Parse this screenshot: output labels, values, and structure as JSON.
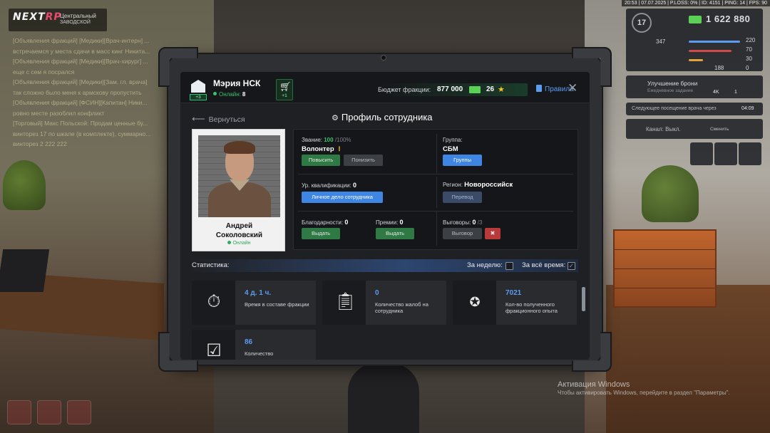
{
  "hud": {
    "logo_main": "NEXT",
    "logo_accent": "RP",
    "server_name": "Центральный",
    "server_sub": "ЗАВОДСКОЙ",
    "topbar": "20:53 | 07.07.2025 | P.LOSS: 0% | ID: 4151 | PING: 14 | FPS: 90",
    "level": "17",
    "money": "1 622 880",
    "stat_a": "347",
    "stat_b": "220",
    "stat_c": "70",
    "stat_d": "30",
    "stat_e": "0",
    "stat_f": "188",
    "stat_g": "0",
    "armor_upgrade": "Улучшение брони",
    "armor_sub": "Ежедневное задание",
    "armor_4k": "4K",
    "armor_1": "1",
    "doctor_visit_label": "Следующее посещение врача через",
    "doctor_visit_time": "04:09",
    "channel_label": "Канал: Выкл.",
    "channel_change": "Сменить"
  },
  "chat": [
    "[Объявления фракций] [Медики][Врач-интерн] ...",
    "встречаемся у места сдачи в масс кинг Никита...",
    "[Объявления фракций] [Медики][Врач-хирург] ...",
    "еще с сем я посрался",
    "[Объявления фракций] [Медики][Зам. гл. врача]",
    "так сложно было меня к армскову пропустить",
    "[Объявления фракций] [ФСИН][Капитан] Ники...",
    "ровно месте разоблил конфликт",
    "[Торговый] Макс Польской: Продам ценные бу...",
    "винторез 17 по шкале (в комплекте), суммарно...",
    "винторез 2 222 222"
  ],
  "header": {
    "title": "Мэрия НСК",
    "online_label": "Онлайн:",
    "online_count": "8",
    "city_level": "+3",
    "cart_level": "+1",
    "budget_label": "Бюджет фракции:",
    "budget_amount": "877 000",
    "budget_count": "26",
    "rules": "Правила",
    "close": "✕"
  },
  "nav": {
    "back": "Вернуться",
    "page_title": "Профиль сотрудника"
  },
  "employee": {
    "first_name": "Андрей",
    "last_name": "Соколовский",
    "status": "Онлайн"
  },
  "info": {
    "rank_label": "Звание:",
    "rank_current": "100",
    "rank_max": "/100%",
    "rank_name": "Волонтер",
    "promote": "Повысить",
    "demote": "Понизить",
    "group_label": "Группа:",
    "group_name": "СБМ",
    "groups_btn": "Группы",
    "qual_label": "Ур. квалификации:",
    "qual_value": "0",
    "personal_file_btn": "Личное дело сотрудника",
    "region_label": "Регион:",
    "region_value": "Новороссийск",
    "transfer_btn": "Перевод",
    "thanks_label": "Благодарности:",
    "thanks_value": "0",
    "thanks_btn": "Выдать",
    "bonus_label": "Премии:",
    "bonus_value": "0",
    "bonus_btn": "Выдать",
    "reprimand_label": "Выговоры:",
    "reprimand_value": "0",
    "reprimand_max": "/3",
    "reprimand_btn": "Выговор"
  },
  "stats": {
    "label": "Статистика:",
    "week": "За неделю:",
    "week_checked": false,
    "alltime": "За всё время:",
    "alltime_checked": true,
    "cards": [
      {
        "icon": "stopwatch-icon",
        "value": "4 д. 1 ч.",
        "desc": "Время в составе фракции"
      },
      {
        "icon": "complaint-list-icon",
        "value": "0",
        "desc": "Количество жалоб на сотрудника"
      },
      {
        "icon": "exp-stars-icon",
        "value": "7021",
        "desc": "Кол-во полученного фракционного опыта"
      },
      {
        "icon": "checklist-icon",
        "value": "86",
        "desc": "Количество"
      }
    ]
  },
  "watermark": {
    "title": "Активация Windows",
    "text": "Чтобы активировать Windows, перейдите в раздел \"Параметры\"."
  },
  "colors": {
    "accent_blue": "#3f86e4",
    "accent_green": "#34c46a",
    "button_green": "#2f7a44",
    "button_red": "#b93a3a",
    "star": "#f5c518"
  }
}
